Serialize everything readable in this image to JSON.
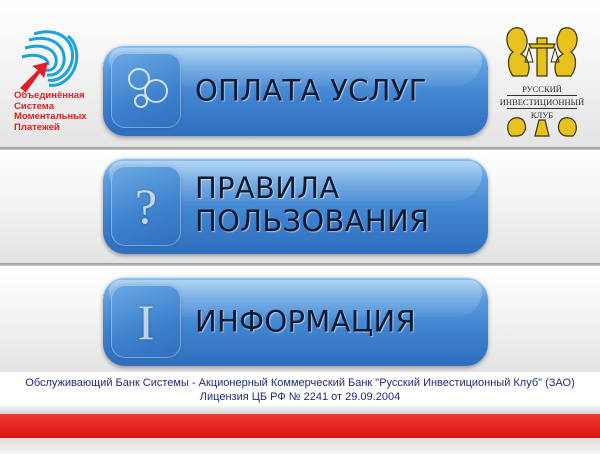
{
  "left_logo": {
    "lines": [
      "Объединённая",
      "Система",
      "Моментальных",
      "Платежей"
    ],
    "icon": "osmp-swirl-arrow-icon"
  },
  "right_logo": {
    "lines": [
      "РУССКИЙ",
      "ИНВЕСТИЦИОННЫЙ",
      "КЛУБ"
    ],
    "icon": "bank-emblem-icon"
  },
  "menu": {
    "pay": {
      "label": "ОПЛАТА УСЛУГ",
      "icon": "bubbles-icon"
    },
    "rules": {
      "label_lines": [
        "ПРАВИЛА",
        "ПОЛЬЗОВАНИЯ"
      ],
      "glyph": "?",
      "icon": "question-icon"
    },
    "info": {
      "label": "ИНФОРМАЦИЯ",
      "glyph": "I",
      "icon": "info-icon"
    }
  },
  "footer": {
    "line1": "Обслуживающий Банк Системы  - Акционерный Коммерческий Банк \"Русский Инвестиционный Клуб\" (ЗАО)",
    "line2": "Лицензия ЦБ РФ № 2241 от 29.09.2004"
  },
  "colors": {
    "button_blue": "#3f82cf",
    "brand_red": "#e21d24",
    "footer_text": "#1f2a7a",
    "emblem_gold": "#e8c21c"
  }
}
